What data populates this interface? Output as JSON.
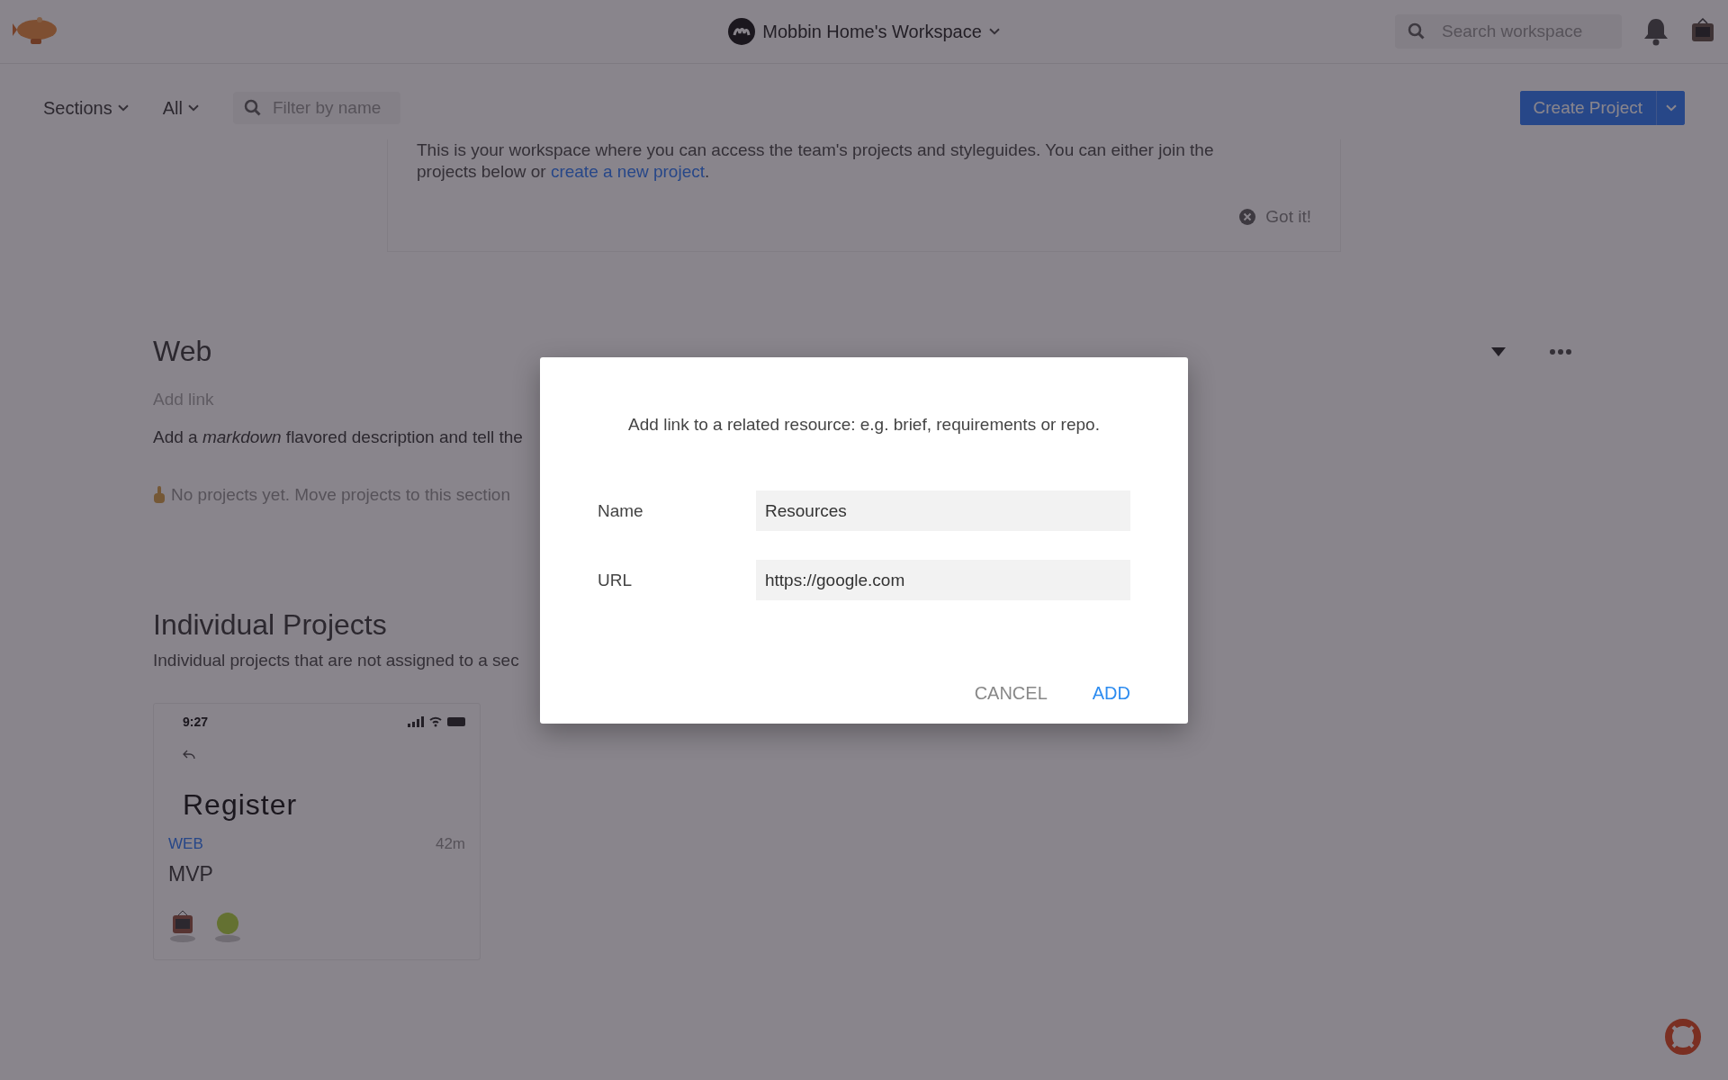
{
  "header": {
    "workspace_name": "Mobbin Home's Workspace",
    "search": {
      "placeholder": "Search workspace"
    }
  },
  "toolbar": {
    "sections_label": "Sections",
    "filter_label": "All",
    "filter": {
      "placeholder": "Filter by name"
    },
    "create_button": "Create Project"
  },
  "notice": {
    "text": "This is your workspace where you can access the team's projects and styleguides. You can either join the projects below or ",
    "link": "create a new project",
    "after_link": ".",
    "dismiss": "Got it!"
  },
  "sections": [
    {
      "title": "Web",
      "add_link": "Add link",
      "description": "Add a *markdown* flavored description and tell the",
      "empty_message": "No projects yet. Move projects to this section"
    }
  ],
  "individual": {
    "title": "Individual Projects",
    "description": "Individual projects that are not assigned to a sec",
    "projects": [
      {
        "preview": {
          "time": "9:27",
          "heading": "Register"
        },
        "tag": "WEB",
        "age": "42m",
        "name": "MVP"
      }
    ]
  },
  "dialog": {
    "prompt": "Add link to a related resource: e.g. brief, requirements or repo.",
    "fields": [
      {
        "label": "Name",
        "value": "Resources"
      },
      {
        "label": "URL",
        "value": "https://google.com"
      }
    ],
    "buttons": [
      {
        "label": "CANCEL",
        "kind": "secondary"
      },
      {
        "label": "ADD",
        "kind": "primary"
      }
    ]
  }
}
